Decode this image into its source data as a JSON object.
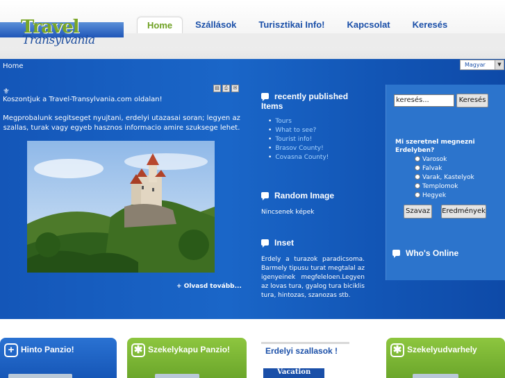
{
  "logo": {
    "line1": "Travel",
    "line2": "Transylvania"
  },
  "nav": [
    {
      "label": "Home",
      "active": true
    },
    {
      "label": "Szállások"
    },
    {
      "label": "Turisztikai Info!"
    },
    {
      "label": "Kapcsolat"
    },
    {
      "label": "Keresés"
    }
  ],
  "breadcrumb": "Home",
  "language": {
    "selected": "Magyar"
  },
  "article": {
    "welcome": "Koszontjuk a Travel-Transylvania.com oldalan!",
    "intro": "Megprobalunk segitseget nyujtani, erdelyi utazasai soran; legyen az szallas, turak vagy egyeb hasznos informacio amire szuksege lehet.",
    "read_more": "Olvasd tovább..."
  },
  "recent": {
    "title_line1": "recently published",
    "title_line2": "Items",
    "items": [
      "Tours",
      "What to see?",
      "Tourist info!",
      "Brasov County!",
      "Covasna County!"
    ]
  },
  "random_image": {
    "title": "Random Image",
    "text": "Nincsenek képek"
  },
  "inset": {
    "title": "Inset",
    "text": "Erdely a turazok paradicsoma. Barmely tipusu turat megtalal az igenyeinek megfeleloen.Legyen az lovas tura, gyalog tura biciklis tura, hintozas, szanozas stb."
  },
  "search": {
    "value": "keresés...",
    "button": "Keresés"
  },
  "poll": {
    "question": "Mi szeretnel megnezni Erdelyben?",
    "options": [
      "Varosok",
      "Falvak",
      "Varak, Kastelyok",
      "Templomok",
      "Hegyek"
    ],
    "vote_button": "Szavaz",
    "results_button": "Eredmények"
  },
  "whos_online": "Who's Online",
  "footer_boxes": [
    {
      "title": "Hinto Panzio!",
      "icon": "plus-icon",
      "color": "#1e63c4"
    },
    {
      "title": "Szekelykapu Panzio!",
      "icon": "asterisk-icon",
      "color": "#7cb834"
    },
    {
      "title": "Erdelyi szallasok !",
      "banner": "Vacation"
    },
    {
      "title": "Szekelyudvarhely",
      "icon": "asterisk-icon",
      "color": "#7cb834"
    }
  ]
}
